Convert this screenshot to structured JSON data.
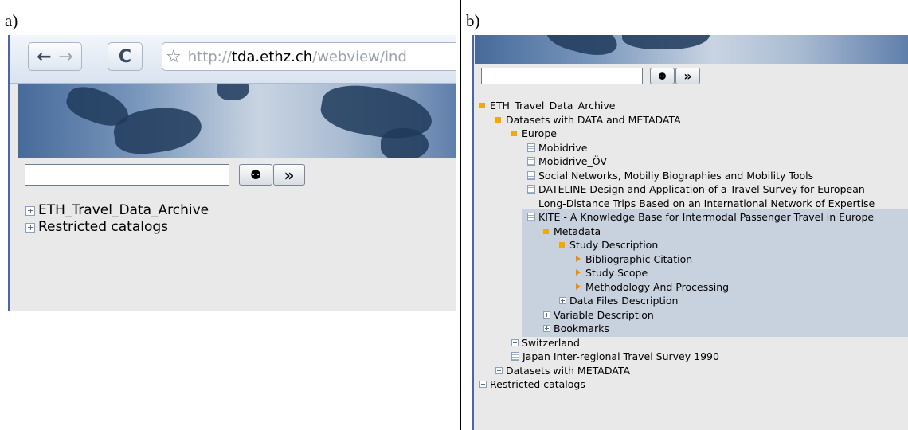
{
  "panel_a": {
    "label": "a)",
    "browser": {
      "back_glyph": "←",
      "forward_glyph": "→",
      "reload_glyph": "C",
      "star_glyph": "☆",
      "url_protocol": "http://",
      "url_host": "tda.ethz.ch",
      "url_path": "/webview/ind"
    },
    "search": {
      "value": "",
      "find_glyph": "⚉",
      "go_glyph": "»"
    },
    "tree": [
      {
        "label": "ETH_Travel_Data_Archive",
        "icon": "plus-box-icon"
      },
      {
        "label": "Restricted catalogs",
        "icon": "plus-box-icon"
      }
    ]
  },
  "panel_b": {
    "label": "b)",
    "search": {
      "value": "",
      "find_glyph": "⚉",
      "go_glyph": "»"
    },
    "tree": [
      {
        "label": "ETH_Travel_Data_Archive",
        "icon": "folder-open-icon",
        "level": 0
      },
      {
        "label": "Datasets with DATA and METADATA",
        "icon": "folder-open-icon",
        "level": 1
      },
      {
        "label": "Europe",
        "icon": "folder-open-icon",
        "level": 2
      },
      {
        "label": "Mobidrive",
        "icon": "document-icon",
        "level": 3
      },
      {
        "label": "Mobidrive_ÖV",
        "icon": "document-icon",
        "level": 3
      },
      {
        "label": "Social Networks, Mobiliy Biographies and Mobility Tools",
        "icon": "document-icon",
        "level": 3
      },
      {
        "label": "DATELINE Design and Application of a Travel Survey for European Long-Distance Trips Based on an International Network of Expertise",
        "icon": "document-icon",
        "level": 3
      },
      {
        "label": "KITE - A Knowledge Base for Intermodal Passenger Travel in Europe",
        "icon": "document-icon",
        "level": 3,
        "highlight": true
      },
      {
        "label": "Metadata",
        "icon": "folder-open-icon",
        "level": 4,
        "highlight": true
      },
      {
        "label": "Study Description",
        "icon": "folder-open-icon",
        "level": 5,
        "highlight": true
      },
      {
        "label": "Bibliographic Citation",
        "icon": "arrow-right-icon",
        "level": 6,
        "highlight": true
      },
      {
        "label": "Study Scope",
        "icon": "arrow-right-icon",
        "level": 6,
        "highlight": true
      },
      {
        "label": "Methodology And Processing",
        "icon": "arrow-right-icon",
        "level": 6,
        "highlight": true
      },
      {
        "label": "Data Files Description",
        "icon": "plus-box-icon",
        "level": 5,
        "highlight": true
      },
      {
        "label": "Variable Description",
        "icon": "plus-box-icon",
        "level": 4,
        "highlight": true
      },
      {
        "label": "Bookmarks",
        "icon": "plus-box-icon",
        "level": 4,
        "highlight": true
      },
      {
        "label": "Switzerland",
        "icon": "plus-box-icon",
        "level": 2
      },
      {
        "label": "Japan Inter-regional Travel Survey 1990",
        "icon": "document-icon",
        "level": 2
      },
      {
        "label": "Datasets with METADATA",
        "icon": "plus-box-icon",
        "level": 1
      },
      {
        "label": "Restricted catalogs",
        "icon": "plus-box-icon",
        "level": 0
      }
    ]
  }
}
